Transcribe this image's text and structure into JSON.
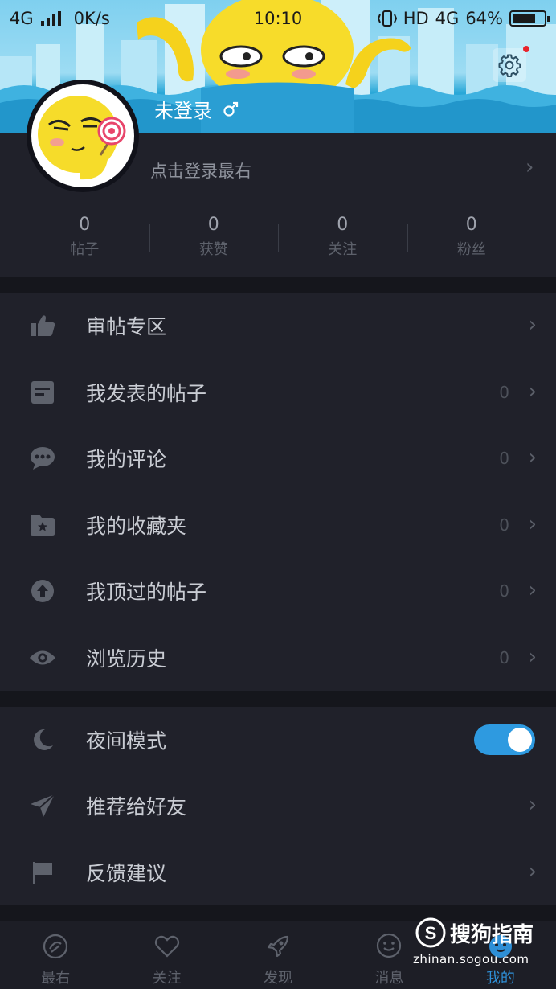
{
  "status_bar": {
    "network": "4G",
    "speed": "0K/s",
    "time": "10:10",
    "hd": "HD",
    "network_right": "4G",
    "battery": "64%"
  },
  "header": {
    "username": "未登录",
    "gender_icon": "male-icon",
    "settings_icon": "gear-icon",
    "notification_dot_color": "#e8242c"
  },
  "profile": {
    "login_hint": "点击登录最右",
    "stats": [
      {
        "value": "0",
        "label": "帖子"
      },
      {
        "value": "0",
        "label": "获赞"
      },
      {
        "value": "0",
        "label": "关注"
      },
      {
        "value": "0",
        "label": "粉丝"
      }
    ]
  },
  "menu": {
    "section1": [
      {
        "icon": "thumbs-up-icon",
        "label": "审帖专区",
        "count": ""
      },
      {
        "icon": "document-icon",
        "label": "我发表的帖子",
        "count": "0"
      },
      {
        "icon": "chat-bubble-icon",
        "label": "我的评论",
        "count": "0"
      },
      {
        "icon": "star-folder-icon",
        "label": "我的收藏夹",
        "count": "0"
      },
      {
        "icon": "up-arrow-circle-icon",
        "label": "我顶过的帖子",
        "count": "0"
      },
      {
        "icon": "eye-icon",
        "label": "浏览历史",
        "count": "0"
      }
    ],
    "section2": [
      {
        "icon": "moon-icon",
        "label": "夜间模式",
        "toggle": true
      },
      {
        "icon": "paper-plane-icon",
        "label": "推荐给好友"
      },
      {
        "icon": "flag-icon",
        "label": "反馈建议"
      }
    ]
  },
  "bottom_nav": [
    {
      "icon": "zuiyou-icon",
      "label": "最右"
    },
    {
      "icon": "heart-icon",
      "label": "关注"
    },
    {
      "icon": "rocket-icon",
      "label": "发现"
    },
    {
      "icon": "smiley-chat-icon",
      "label": "消息"
    },
    {
      "icon": "me-icon",
      "label": "我的",
      "active": true
    }
  ],
  "watermark": {
    "brand": "搜狗指南",
    "url": "zhinan.sogou.com"
  },
  "colors": {
    "accent": "#2e9ae0",
    "background": "#15161c",
    "panel": "#20212a",
    "header_sky": "#7fd0ef",
    "header_water": "#1c8fc4"
  }
}
